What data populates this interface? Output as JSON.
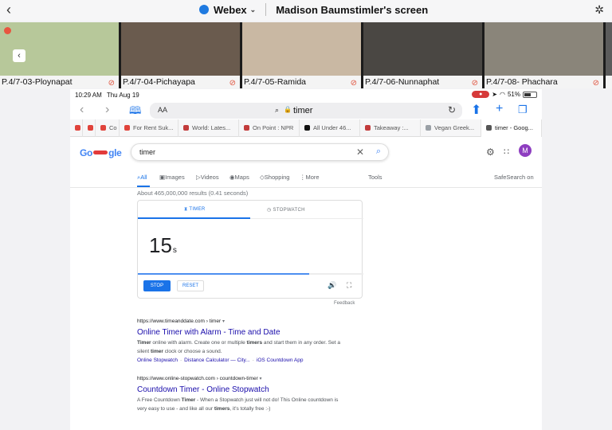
{
  "webex": {
    "app_name": "Webex",
    "screen_title": "Madison Baumstimler's screen"
  },
  "participants": [
    {
      "name": "P.4/7-03-Ploynapat",
      "bg": "#b7c89a"
    },
    {
      "name": "P.4/7-04-Pichayapa",
      "bg": "#6a5b4e"
    },
    {
      "name": "P.4/7-05-Ramida",
      "bg": "#c9b8a3"
    },
    {
      "name": "P.4/7-06-Nunnaphat",
      "bg": "#4a4743"
    },
    {
      "name": "P.4/7-08- Phachara",
      "bg": "#8a857a"
    }
  ],
  "status_bar": {
    "time": "10:29 AM",
    "date": "Thu Aug 19",
    "battery": "51%"
  },
  "browser": {
    "aa": "AA",
    "url": "timer",
    "tabs": [
      {
        "label": "",
        "color": "#e0433b"
      },
      {
        "label": "",
        "color": "#e0433b"
      },
      {
        "label": "Co",
        "color": "#e0433b"
      },
      {
        "label": "For Rent Suk...",
        "color": "#e0433b"
      },
      {
        "label": "World: Lates...",
        "color": "#c23b3b"
      },
      {
        "label": "On Point : NPR",
        "color": "#c23b3b"
      },
      {
        "label": "All Under 46...",
        "color": "#111111"
      },
      {
        "label": "Takeaway :...",
        "color": "#c23b3b"
      },
      {
        "label": "Vegan Greek...",
        "color": "#9aa0a6"
      },
      {
        "label": "timer - Goog...",
        "color": "#555555"
      }
    ]
  },
  "google": {
    "query": "timer",
    "avatar": "M",
    "nav": {
      "all": "All",
      "images": "Images",
      "videos": "Videos",
      "maps": "Maps",
      "shopping": "Shopping",
      "more": "More",
      "tools": "Tools",
      "safesearch": "SafeSearch on"
    },
    "stats": "About 465,000,000 results (0.41 seconds)",
    "timer_widget": {
      "tab_timer": "TIMER",
      "tab_stopwatch": "STOPWATCH",
      "value": "15",
      "unit": "s",
      "progress": 0.76,
      "stop": "STOP",
      "reset": "RESET",
      "feedback": "Feedback"
    },
    "results": [
      {
        "url": "https://www.timeanddate.com › timer",
        "title": "Online Timer with Alarm - Time and Date",
        "snippet_lines": [
          "Timer online with alarm. Create one or multiple timers and start them in any order. Set a",
          "silent timer clock or choose a sound."
        ],
        "links": [
          "Online Stopwatch",
          "Distance Calculator — City...",
          "iOS Countdown App"
        ]
      },
      {
        "url": "https://www.online-stopwatch.com › countdown-timer",
        "title": "Countdown Timer - Online Stopwatch",
        "snippet_lines": [
          "A Free Countdown Timer - When a Stopwatch just will not do! This Online countdown is",
          "very easy to use - and like all our timers, it's totally free :-)"
        ],
        "links": []
      }
    ]
  }
}
